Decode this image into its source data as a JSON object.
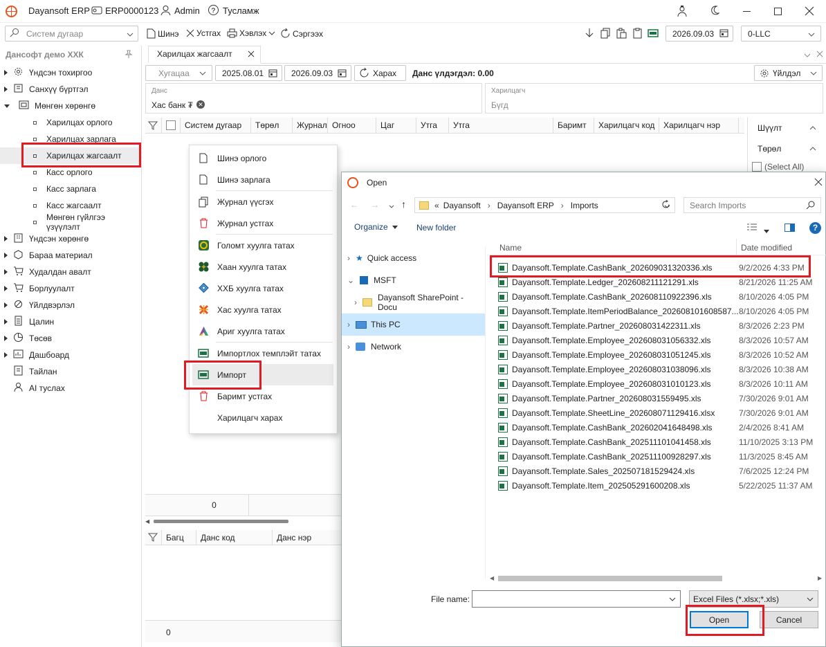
{
  "titlebar": {
    "app_name": "Dayansoft ERP",
    "company_code": "ERP0000123",
    "user": "Admin",
    "help": "Тусламж"
  },
  "toolbar": {
    "search_placeholder": "Систем дугаар",
    "new_label": "Шинэ",
    "delete_label": "Устгах",
    "print_label": "Хэвлэх",
    "refresh_label": "Сэргээх",
    "date": "2026.09.03",
    "company": "0-LLC"
  },
  "sidebar": {
    "org": "Дансофт демо ХХК",
    "items": [
      {
        "label": "Үндсэн тохиргоо",
        "icon": "gear-icon"
      },
      {
        "label": "Санхүү бүртгэл",
        "icon": "book-icon"
      },
      {
        "label": "Мөнгөн хөрөнгө",
        "icon": "cash-icon"
      }
    ],
    "sub_items": [
      {
        "label": "Харилцах орлого"
      },
      {
        "label": "Харилцах зарлага"
      },
      {
        "label": "Харилцах жагсаалт"
      },
      {
        "label": "Касс орлого"
      },
      {
        "label": "Касс зарлага"
      },
      {
        "label": "Касс жагсаалт"
      },
      {
        "label": "Мөнгөн гүйлгээ үзүүлэлт"
      }
    ],
    "items2": [
      {
        "label": "Үндсэн хөрөнгө",
        "icon": "building-icon"
      },
      {
        "label": "Бараа материал",
        "icon": "box-icon"
      },
      {
        "label": "Худалдан авалт",
        "icon": "cart-icon"
      },
      {
        "label": "Борлуулалт",
        "icon": "cart-icon"
      },
      {
        "label": "Үйлдвэрлэл",
        "icon": "factory-icon"
      },
      {
        "label": "Цалин",
        "icon": "document-icon"
      },
      {
        "label": "Төсөв",
        "icon": "pie-icon"
      },
      {
        "label": "Дашбоард",
        "icon": "dashboard-icon"
      },
      {
        "label": "Тайлан",
        "icon": "report-icon"
      },
      {
        "label": "AI туслах",
        "icon": "person-icon"
      }
    ]
  },
  "tab": {
    "label": "Харилцах жагсаалт"
  },
  "filters": {
    "period": "Хугацаа",
    "date_from": "2025.08.01",
    "date_to": "2026.09.03",
    "view_label": "Харах",
    "balance_label": "Данс үлдэгдэл: 0.00",
    "actions_label": "Үйлдэл",
    "account_label": "Данс",
    "account_value": "Хас банк ₮",
    "partner_label": "Харилцагч",
    "partner_value": "Бүгд"
  },
  "grid": {
    "columns": [
      "Систем дугаар",
      "Төрөл",
      "Журнал",
      "Огноо",
      "Цаг",
      "Утга",
      "Утга",
      "Баримт",
      "Харилцагч код",
      "Харилцагч нэр"
    ],
    "total": "0"
  },
  "bottom_grid": {
    "columns": [
      "Багц",
      "Данс код",
      "Данс нэр"
    ],
    "total": "0"
  },
  "filter_panel": {
    "title": "Шүүлт",
    "type_label": "Төрөл",
    "select_all": "(Select All)"
  },
  "context_menu": {
    "items": [
      {
        "label": "Шинэ орлого"
      },
      {
        "label": "Шинэ зарлага"
      },
      {
        "label": "Журнал үүсгэх"
      },
      {
        "label": "Журнал устгах"
      },
      {
        "label": "Голомт хуулга татах"
      },
      {
        "label": "Хаан хуулга татах"
      },
      {
        "label": "ХХБ хуулга татах"
      },
      {
        "label": "Хас хуулга татах"
      },
      {
        "label": "Ариг хуулга татах"
      },
      {
        "label": "Импортлох темплэйт татах"
      },
      {
        "label": "Импорт"
      },
      {
        "label": "Баримт устгах"
      },
      {
        "label": "Харилцагч харах"
      }
    ]
  },
  "dialog": {
    "title": "Open",
    "path": [
      "Dayansoft",
      "Dayansoft ERP",
      "Imports"
    ],
    "path_prefix": "«",
    "search_placeholder": "Search Imports",
    "organize": "Organize",
    "new_folder": "New folder",
    "nav": [
      "Quick access",
      "MSFT",
      "Dayansoft SharePoint - Docu",
      "This PC",
      "Network"
    ],
    "col_name": "Name",
    "col_date": "Date modified",
    "files": [
      {
        "name": "Dayansoft.Template.CashBank_202609031320336.xls",
        "date": "9/2/2026 4:33 PM"
      },
      {
        "name": "Dayansoft.Template.Ledger_202608211121291.xls",
        "date": "8/21/2026 11:25 AM"
      },
      {
        "name": "Dayansoft.Template.CashBank_202608110922396.xls",
        "date": "8/10/2026 4:05 PM"
      },
      {
        "name": "Dayansoft.Template.ItemPeriodBalance_202608101608587....",
        "date": "8/10/2026 4:05 PM"
      },
      {
        "name": "Dayansoft.Template.Partner_202608031422311.xls",
        "date": "8/3/2026 2:23 PM"
      },
      {
        "name": "Dayansoft.Template.Employee_202608031056332.xls",
        "date": "8/3/2026 10:57 AM"
      },
      {
        "name": "Dayansoft.Template.Employee_202608031051245.xls",
        "date": "8/3/2026 10:52 AM"
      },
      {
        "name": "Dayansoft.Template.Employee_202608031038096.xls",
        "date": "8/3/2026 10:38 AM"
      },
      {
        "name": "Dayansoft.Template.Employee_202608031010123.xls",
        "date": "8/3/2026 10:11 AM"
      },
      {
        "name": "Dayansoft.Template.Partner_202608031559495.xls",
        "date": "7/30/2026 9:01 AM"
      },
      {
        "name": "Dayansoft.Template.SheetLine_202608071129416.xlsx",
        "date": "7/30/2026 9:01 AM"
      },
      {
        "name": "Dayansoft.Template.CashBank_202602041648498.xls",
        "date": "2/4/2026 8:41 AM"
      },
      {
        "name": "Dayansoft.Template.CashBank_202511101041458.xls",
        "date": "11/10/2025 3:13 PM"
      },
      {
        "name": "Dayansoft.Template.CashBank_202511100928297.xls",
        "date": "11/3/2025 8:45 AM"
      },
      {
        "name": "Dayansoft.Template.Sales_202507181529424.xls",
        "date": "7/6/2025 12:24 PM"
      },
      {
        "name": "Dayansoft.Template.Item_202505291600208.xls",
        "date": "5/22/2025 11:37 AM"
      }
    ],
    "file_name_label": "File name:",
    "file_name_value": "",
    "file_type": "Excel Files (*.xlsx;*.xls)",
    "open_label": "Open",
    "cancel_label": "Cancel"
  },
  "colors": {
    "accent": "#e01b24",
    "selection": "#cce8ff",
    "excel": "#1e7145"
  }
}
